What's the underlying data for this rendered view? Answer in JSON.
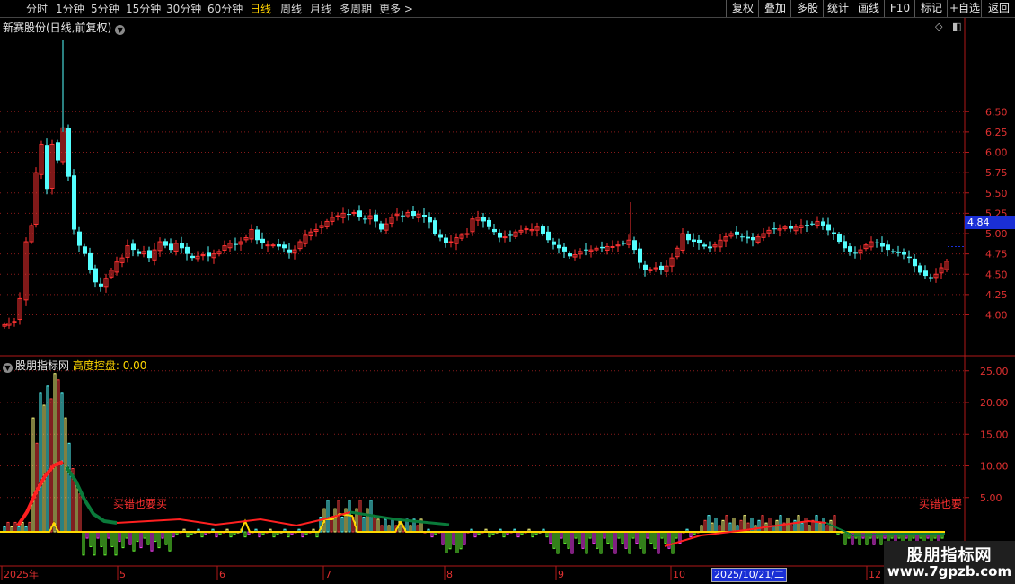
{
  "toolbar": {
    "periods": [
      "分时",
      "1分钟",
      "5分钟",
      "15分钟",
      "30分钟",
      "60分钟",
      "日线",
      "周线",
      "月线",
      "多周期",
      "更多 >"
    ],
    "active_period": "日线",
    "right_buttons": [
      "复权",
      "叠加",
      "多股",
      "统计",
      "画线",
      "F10",
      "标记",
      "+自选",
      "返回"
    ]
  },
  "main_chart": {
    "title": "新赛股份(日线,前复权)",
    "y_ticks": [
      "6.50",
      "6.25",
      "6.00",
      "5.75",
      "5.50",
      "5.25",
      "5.00",
      "4.75",
      "4.50",
      "4.25",
      "4.00"
    ],
    "current_price": "4.84"
  },
  "indicator": {
    "name": "股朋指标网",
    "label": "高度控盘:",
    "value": "0.00",
    "y_ticks": [
      "25.00",
      "20.00",
      "15.00",
      "10.00",
      "5.00"
    ],
    "annotations": [
      "买错也要买",
      "买错也要"
    ]
  },
  "x_axis": {
    "labels": [
      "2025年",
      "5",
      "6",
      "7",
      "8",
      "9",
      "10",
      "12"
    ],
    "cursor_date": "2025/10/21/二"
  },
  "watermark": {
    "title": "股朋指标网",
    "url": "www.7gpzb.com"
  },
  "colors": {
    "up": "#ff3232",
    "down": "#54ffff",
    "grid": "#8a1a1a",
    "axis": "#b01818",
    "accent_yellow": "#ffd800",
    "price_tag": "#1a2fd6"
  }
}
